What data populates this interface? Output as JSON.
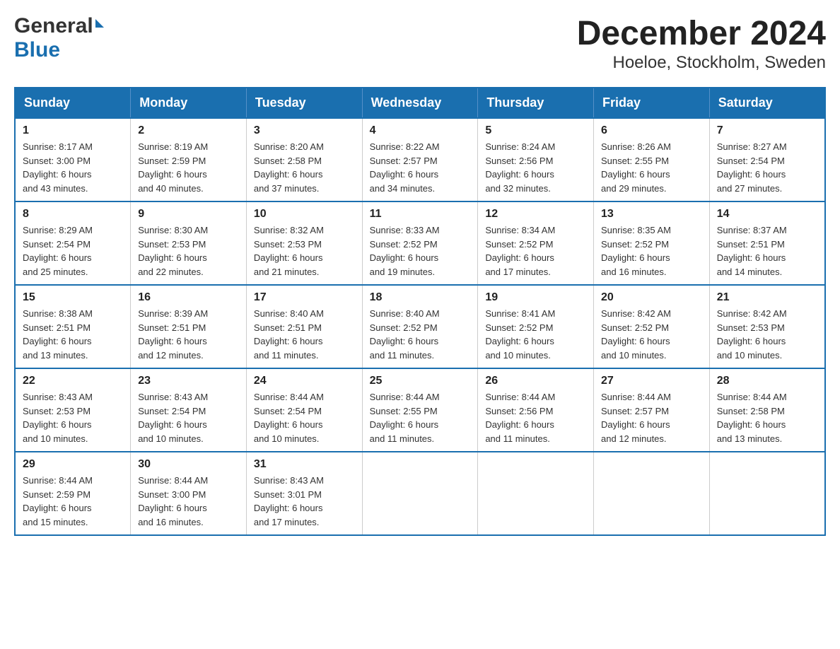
{
  "header": {
    "logo_general": "General",
    "logo_blue": "Blue",
    "title": "December 2024",
    "subtitle": "Hoeloe, Stockholm, Sweden"
  },
  "weekdays": [
    "Sunday",
    "Monday",
    "Tuesday",
    "Wednesday",
    "Thursday",
    "Friday",
    "Saturday"
  ],
  "weeks": [
    [
      {
        "day": "1",
        "info": "Sunrise: 8:17 AM\nSunset: 3:00 PM\nDaylight: 6 hours\nand 43 minutes."
      },
      {
        "day": "2",
        "info": "Sunrise: 8:19 AM\nSunset: 2:59 PM\nDaylight: 6 hours\nand 40 minutes."
      },
      {
        "day": "3",
        "info": "Sunrise: 8:20 AM\nSunset: 2:58 PM\nDaylight: 6 hours\nand 37 minutes."
      },
      {
        "day": "4",
        "info": "Sunrise: 8:22 AM\nSunset: 2:57 PM\nDaylight: 6 hours\nand 34 minutes."
      },
      {
        "day": "5",
        "info": "Sunrise: 8:24 AM\nSunset: 2:56 PM\nDaylight: 6 hours\nand 32 minutes."
      },
      {
        "day": "6",
        "info": "Sunrise: 8:26 AM\nSunset: 2:55 PM\nDaylight: 6 hours\nand 29 minutes."
      },
      {
        "day": "7",
        "info": "Sunrise: 8:27 AM\nSunset: 2:54 PM\nDaylight: 6 hours\nand 27 minutes."
      }
    ],
    [
      {
        "day": "8",
        "info": "Sunrise: 8:29 AM\nSunset: 2:54 PM\nDaylight: 6 hours\nand 25 minutes."
      },
      {
        "day": "9",
        "info": "Sunrise: 8:30 AM\nSunset: 2:53 PM\nDaylight: 6 hours\nand 22 minutes."
      },
      {
        "day": "10",
        "info": "Sunrise: 8:32 AM\nSunset: 2:53 PM\nDaylight: 6 hours\nand 21 minutes."
      },
      {
        "day": "11",
        "info": "Sunrise: 8:33 AM\nSunset: 2:52 PM\nDaylight: 6 hours\nand 19 minutes."
      },
      {
        "day": "12",
        "info": "Sunrise: 8:34 AM\nSunset: 2:52 PM\nDaylight: 6 hours\nand 17 minutes."
      },
      {
        "day": "13",
        "info": "Sunrise: 8:35 AM\nSunset: 2:52 PM\nDaylight: 6 hours\nand 16 minutes."
      },
      {
        "day": "14",
        "info": "Sunrise: 8:37 AM\nSunset: 2:51 PM\nDaylight: 6 hours\nand 14 minutes."
      }
    ],
    [
      {
        "day": "15",
        "info": "Sunrise: 8:38 AM\nSunset: 2:51 PM\nDaylight: 6 hours\nand 13 minutes."
      },
      {
        "day": "16",
        "info": "Sunrise: 8:39 AM\nSunset: 2:51 PM\nDaylight: 6 hours\nand 12 minutes."
      },
      {
        "day": "17",
        "info": "Sunrise: 8:40 AM\nSunset: 2:51 PM\nDaylight: 6 hours\nand 11 minutes."
      },
      {
        "day": "18",
        "info": "Sunrise: 8:40 AM\nSunset: 2:52 PM\nDaylight: 6 hours\nand 11 minutes."
      },
      {
        "day": "19",
        "info": "Sunrise: 8:41 AM\nSunset: 2:52 PM\nDaylight: 6 hours\nand 10 minutes."
      },
      {
        "day": "20",
        "info": "Sunrise: 8:42 AM\nSunset: 2:52 PM\nDaylight: 6 hours\nand 10 minutes."
      },
      {
        "day": "21",
        "info": "Sunrise: 8:42 AM\nSunset: 2:53 PM\nDaylight: 6 hours\nand 10 minutes."
      }
    ],
    [
      {
        "day": "22",
        "info": "Sunrise: 8:43 AM\nSunset: 2:53 PM\nDaylight: 6 hours\nand 10 minutes."
      },
      {
        "day": "23",
        "info": "Sunrise: 8:43 AM\nSunset: 2:54 PM\nDaylight: 6 hours\nand 10 minutes."
      },
      {
        "day": "24",
        "info": "Sunrise: 8:44 AM\nSunset: 2:54 PM\nDaylight: 6 hours\nand 10 minutes."
      },
      {
        "day": "25",
        "info": "Sunrise: 8:44 AM\nSunset: 2:55 PM\nDaylight: 6 hours\nand 11 minutes."
      },
      {
        "day": "26",
        "info": "Sunrise: 8:44 AM\nSunset: 2:56 PM\nDaylight: 6 hours\nand 11 minutes."
      },
      {
        "day": "27",
        "info": "Sunrise: 8:44 AM\nSunset: 2:57 PM\nDaylight: 6 hours\nand 12 minutes."
      },
      {
        "day": "28",
        "info": "Sunrise: 8:44 AM\nSunset: 2:58 PM\nDaylight: 6 hours\nand 13 minutes."
      }
    ],
    [
      {
        "day": "29",
        "info": "Sunrise: 8:44 AM\nSunset: 2:59 PM\nDaylight: 6 hours\nand 15 minutes."
      },
      {
        "day": "30",
        "info": "Sunrise: 8:44 AM\nSunset: 3:00 PM\nDaylight: 6 hours\nand 16 minutes."
      },
      {
        "day": "31",
        "info": "Sunrise: 8:43 AM\nSunset: 3:01 PM\nDaylight: 6 hours\nand 17 minutes."
      },
      null,
      null,
      null,
      null
    ]
  ]
}
